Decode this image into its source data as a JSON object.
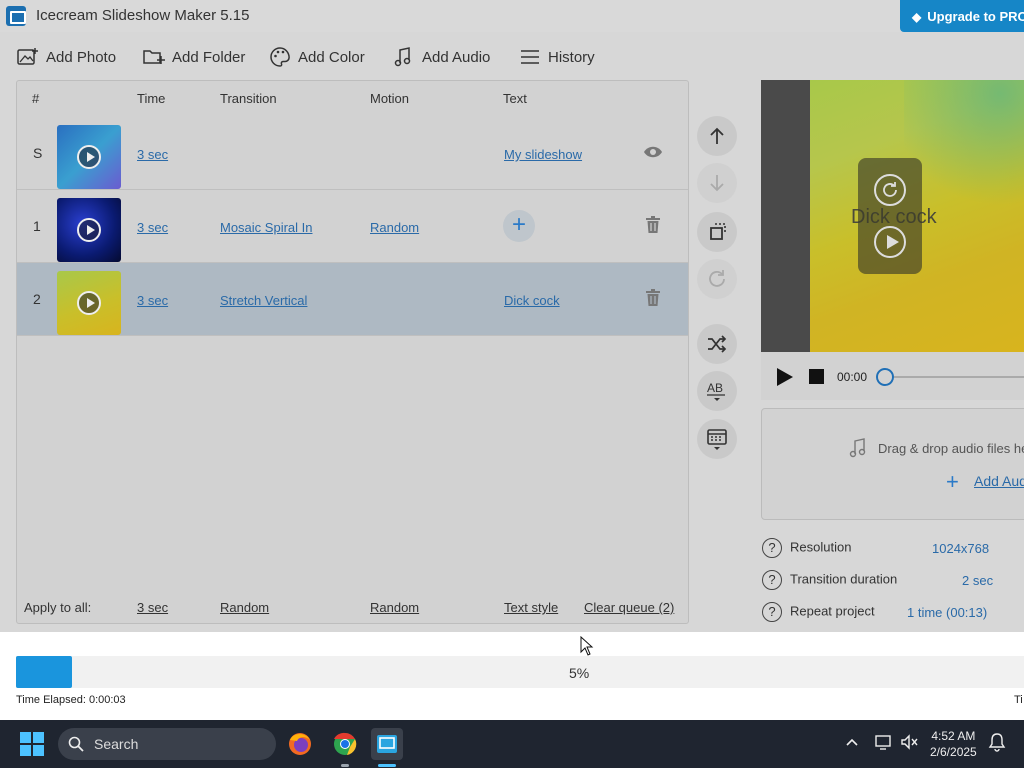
{
  "window": {
    "title": "Icecream Slideshow Maker 5.15",
    "upgrade_label": "Upgrade to PRO"
  },
  "toolbar": {
    "add_photo": "Add Photo",
    "add_folder": "Add Folder",
    "add_color": "Add Color",
    "add_audio": "Add Audio",
    "history": "History"
  },
  "table": {
    "headers": {
      "num": "#",
      "time": "Time",
      "transition": "Transition",
      "motion": "Motion",
      "text": "Text"
    },
    "rows": [
      {
        "num": "S",
        "time": "3 sec",
        "transition": "",
        "motion": "",
        "text": "My slideshow"
      },
      {
        "num": "1",
        "time": "3 sec",
        "transition": "Mosaic Spiral In",
        "motion": "Random",
        "text": ""
      },
      {
        "num": "2",
        "time": "3 sec",
        "transition": "Stretch Vertical",
        "motion": "",
        "text": "Dick cock"
      }
    ],
    "footer": {
      "label": "Apply to all:",
      "time": "3 sec",
      "transition": "Random",
      "motion": "Random",
      "text_style": "Text style",
      "clear_queue": "Clear queue (2)"
    }
  },
  "preview": {
    "caption": "Dick cock",
    "time": "00:00"
  },
  "audio": {
    "drop_text": "Drag & drop audio files here",
    "add_audio": "Add Audio"
  },
  "settings": {
    "resolution_label": "Resolution",
    "resolution_value": "1024x768",
    "transition_label": "Transition duration",
    "transition_value": "2 sec",
    "repeat_label": "Repeat project",
    "repeat_value": "1 time (00:13)"
  },
  "progress": {
    "percent_label": "5%",
    "percent": 5,
    "elapsed": "Time Elapsed: 0:00:03",
    "remaining_prefix": "Ti"
  },
  "taskbar": {
    "search_label": "Search",
    "time": "4:52 AM",
    "date": "2/6/2025"
  },
  "colors": {
    "accent": "#1a95dd",
    "link": "#2a6aa8",
    "selected_row": "#aeb9c3"
  }
}
